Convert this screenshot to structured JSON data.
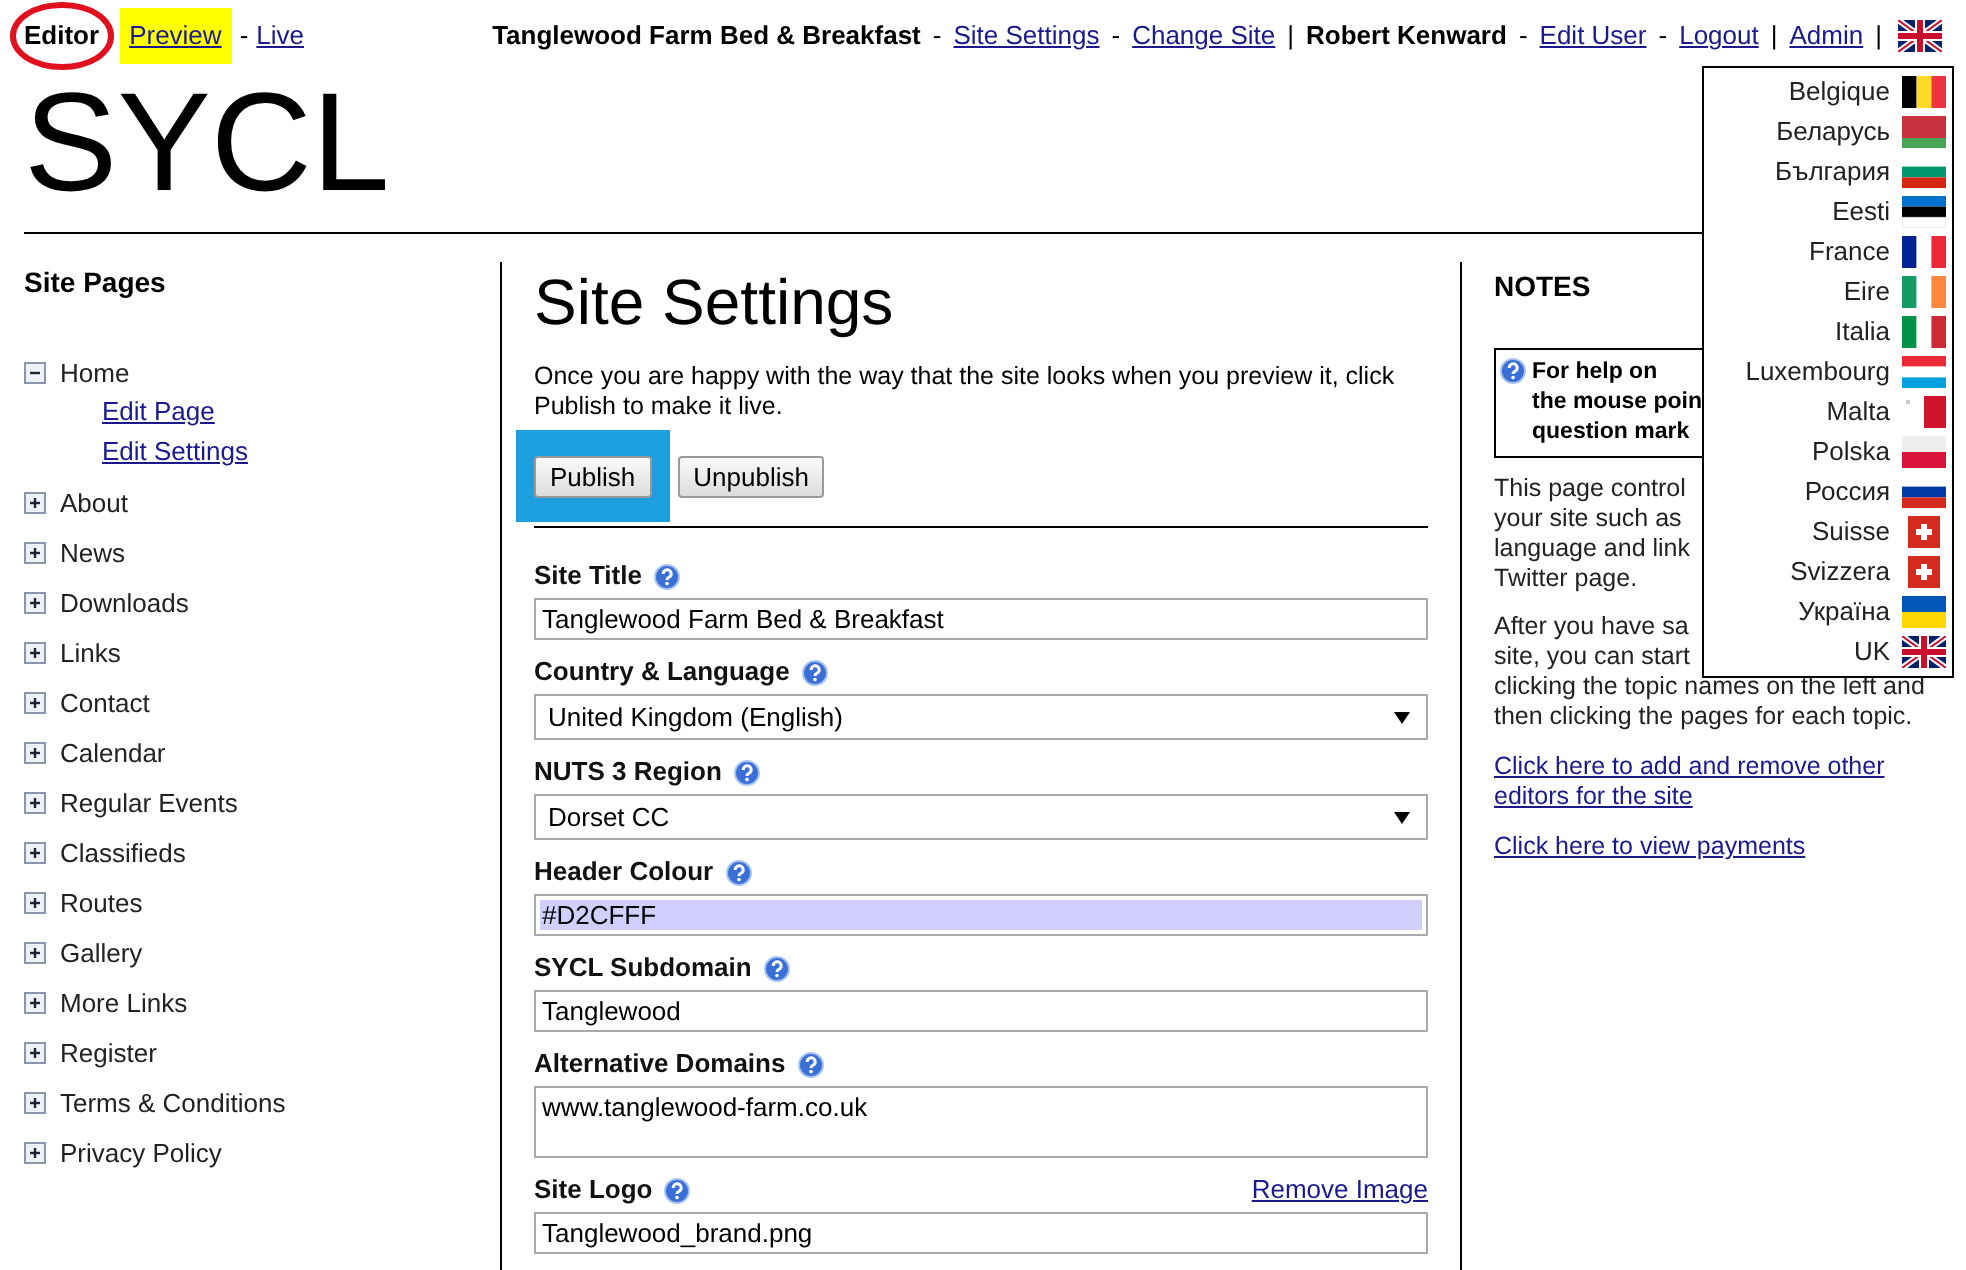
{
  "top_bar": {
    "left": [
      {
        "kind": "text",
        "text": "Editor",
        "circled": true,
        "highlighted": false
      },
      {
        "kind": "link",
        "text": "Preview",
        "circled": false,
        "highlighted": true
      },
      {
        "kind": "separator",
        "text": "-",
        "circled": false,
        "highlighted": false
      },
      {
        "kind": "link",
        "text": "Live",
        "circled": false,
        "highlighted": false
      }
    ],
    "right": [
      {
        "kind": "text",
        "text": "Tanglewood Farm Bed & Breakfast"
      },
      {
        "kind": "separator",
        "text": "-"
      },
      {
        "kind": "link",
        "text": "Site Settings"
      },
      {
        "kind": "separator",
        "text": "-"
      },
      {
        "kind": "link",
        "text": "Change Site"
      },
      {
        "kind": "separator",
        "text": "|"
      },
      {
        "kind": "text",
        "text": "Robert Kenward"
      },
      {
        "kind": "separator",
        "text": "-"
      },
      {
        "kind": "link",
        "text": "Edit User"
      },
      {
        "kind": "separator",
        "text": "-"
      },
      {
        "kind": "link",
        "text": "Logout"
      },
      {
        "kind": "separator",
        "text": "|"
      },
      {
        "kind": "link",
        "text": "Admin"
      },
      {
        "kind": "separator",
        "text": "|"
      }
    ]
  },
  "logo": "SYCL",
  "language_menu": {
    "items": [
      {
        "label": "Belgique"
      },
      {
        "label": "Беларусь"
      },
      {
        "label": "България"
      },
      {
        "label": "Eesti"
      },
      {
        "label": "France"
      },
      {
        "label": "Eire"
      },
      {
        "label": "Italia"
      },
      {
        "label": "Luxembourg"
      },
      {
        "label": "Malta"
      },
      {
        "label": "Polska"
      },
      {
        "label": "Россия"
      },
      {
        "label": "Suisse"
      },
      {
        "label": "Svizzera"
      },
      {
        "label": "Україна"
      },
      {
        "label": "UK"
      }
    ]
  },
  "sidebar": {
    "title": "Site Pages",
    "items": [
      {
        "label": "Home",
        "expanded": true,
        "children": [
          {
            "label": "Edit Page"
          },
          {
            "label": "Edit Settings"
          }
        ]
      },
      {
        "label": "About",
        "expanded": false
      },
      {
        "label": "News",
        "expanded": false
      },
      {
        "label": "Downloads",
        "expanded": false
      },
      {
        "label": "Links",
        "expanded": false
      },
      {
        "label": "Contact",
        "expanded": false
      },
      {
        "label": "Calendar",
        "expanded": false
      },
      {
        "label": "Regular Events",
        "expanded": false
      },
      {
        "label": "Classifieds",
        "expanded": false
      },
      {
        "label": "Routes",
        "expanded": false
      },
      {
        "label": "Gallery",
        "expanded": false
      },
      {
        "label": "More Links",
        "expanded": false
      },
      {
        "label": "Register",
        "expanded": false
      },
      {
        "label": "Terms & Conditions",
        "expanded": false
      },
      {
        "label": "Privacy Policy",
        "expanded": false
      }
    ]
  },
  "main": {
    "title": "Site Settings",
    "intro": "Once you are happy with the way that the site looks when you preview it, click Publish to make it live.",
    "buttons": [
      {
        "label": "Publish",
        "highlighted": true
      },
      {
        "label": "Unpublish",
        "highlighted": false
      }
    ],
    "fields": [
      {
        "kind": "text",
        "label": "Site Title",
        "value": "Tanglewood Farm Bed & Breakfast"
      },
      {
        "kind": "select",
        "label": "Country & Language",
        "value": "United Kingdom (English)"
      },
      {
        "kind": "select",
        "label": "NUTS 3 Region",
        "value": "Dorset CC"
      },
      {
        "kind": "color",
        "label": "Header Colour",
        "value": "#D2CFFF"
      },
      {
        "kind": "text",
        "label": "SYCL Subdomain",
        "value": "Tanglewood"
      },
      {
        "kind": "textarea",
        "label": "Alternative Domains",
        "value": "www.tanglewood-farm.co.uk"
      },
      {
        "kind": "text",
        "label": "Site Logo",
        "value": "Tanglewood_brand.png",
        "action": "Remove Image"
      }
    ]
  },
  "notes": {
    "title": "NOTES",
    "help_lines": [
      "For help on",
      "the mouse poin",
      "question mark"
    ],
    "paragraphs": [
      [
        "This page control",
        "your site such as",
        "language and link",
        "Twitter page."
      ],
      [
        "After you have sa",
        "site, you can start",
        "clicking the topic names on the left and",
        "then clicking the pages for each topic."
      ]
    ],
    "links": [
      "Click here to add and remove other editors for the site",
      "Click here to view payments"
    ]
  }
}
